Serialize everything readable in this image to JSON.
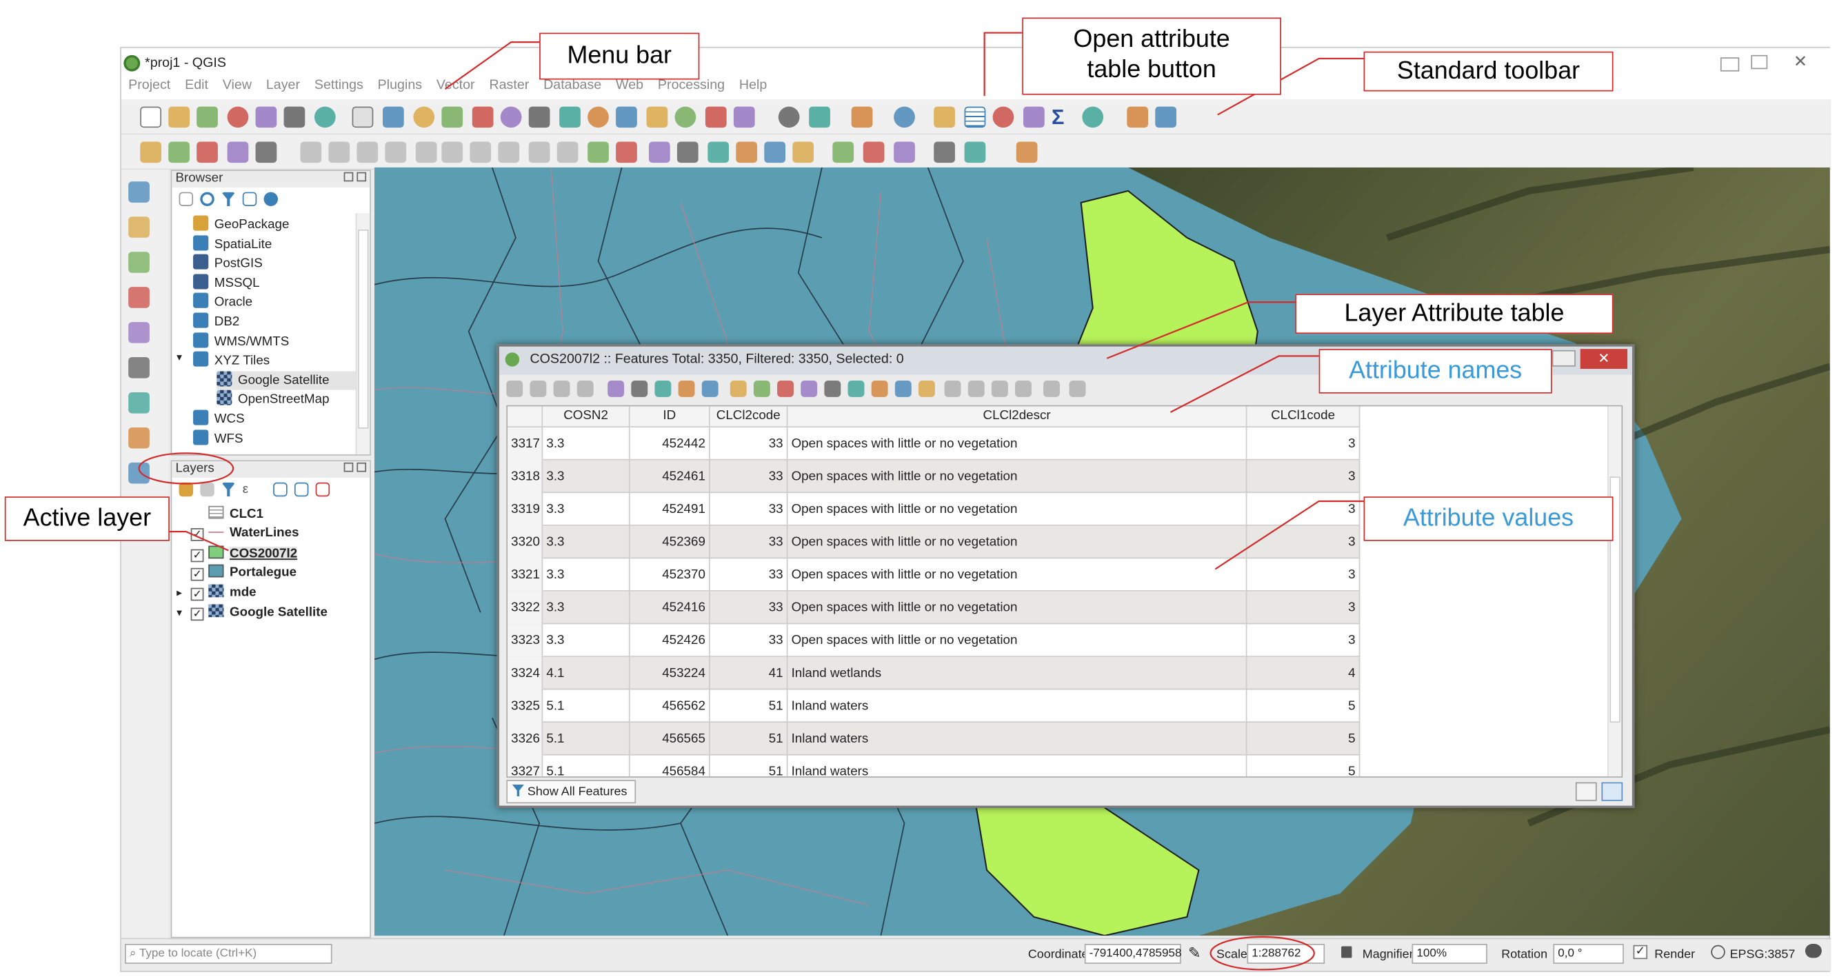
{
  "app": {
    "title": "*proj1 - QGIS"
  },
  "menu": [
    "Project",
    "Edit",
    "View",
    "Layer",
    "Settings",
    "Plugins",
    "Vector",
    "Raster",
    "Database",
    "Web",
    "Processing",
    "Help"
  ],
  "browser": {
    "title": "Browser",
    "items": [
      {
        "label": "GeoPackage",
        "icon": "geopackage-icon"
      },
      {
        "label": "SpatiaLite",
        "icon": "spatialite-icon"
      },
      {
        "label": "PostGIS",
        "icon": "postgis-icon"
      },
      {
        "label": "MSSQL",
        "icon": "mssql-icon"
      },
      {
        "label": "Oracle",
        "icon": "oracle-icon"
      },
      {
        "label": "DB2",
        "icon": "db2-icon"
      },
      {
        "label": "WMS/WMTS",
        "icon": "wms-icon"
      },
      {
        "label": "XYZ Tiles",
        "icon": "xyz-icon"
      },
      {
        "label": "Google Satellite",
        "icon": "tiles-icon"
      },
      {
        "label": "OpenStreetMap",
        "icon": "tiles-icon"
      },
      {
        "label": "WCS",
        "icon": "wcs-icon"
      },
      {
        "label": "WFS",
        "icon": "wfs-icon"
      }
    ]
  },
  "layers": {
    "title": "Layers",
    "items": [
      {
        "label": "CLC1",
        "checked": false,
        "swatch": "table"
      },
      {
        "label": "WaterLines",
        "checked": true,
        "swatch": "line"
      },
      {
        "label": "COS2007l2",
        "checked": true,
        "swatch": "#7fcf7f"
      },
      {
        "label": "Portalegue",
        "checked": true,
        "swatch": "#5b9eb1"
      },
      {
        "label": "mde",
        "checked": true,
        "swatch": "raster"
      },
      {
        "label": "Google Satellite",
        "checked": true,
        "swatch": "raster"
      }
    ]
  },
  "locator": {
    "placeholder": "Type to locate (Ctrl+K)"
  },
  "status": {
    "coordinate_label": "Coordinate",
    "coordinate": "-791400,4785958",
    "scale_label": "Scale",
    "scale": "1:288762",
    "magnifier_label": "Magnifier",
    "magnifier": "100%",
    "rotation_label": "Rotation",
    "rotation": "0,0 °",
    "render_label": "Render",
    "crs": "EPSG:3857"
  },
  "attribute_table": {
    "title": "COS2007l2 :: Features Total: 3350, Filtered: 3350, Selected: 0",
    "columns": [
      "COSN2",
      "ID",
      "CLCl2code",
      "CLCl2descr",
      "CLCl1code"
    ],
    "rows": [
      {
        "n": "3317",
        "cosn2": "3.3",
        "id": "452442",
        "c2": "33",
        "desc": "Open spaces with little or no vegetation",
        "c1": "3"
      },
      {
        "n": "3318",
        "cosn2": "3.3",
        "id": "452461",
        "c2": "33",
        "desc": "Open spaces with little or no vegetation",
        "c1": "3"
      },
      {
        "n": "3319",
        "cosn2": "3.3",
        "id": "452491",
        "c2": "33",
        "desc": "Open spaces with little or no vegetation",
        "c1": "3"
      },
      {
        "n": "3320",
        "cosn2": "3.3",
        "id": "452369",
        "c2": "33",
        "desc": "Open spaces with little or no vegetation",
        "c1": "3"
      },
      {
        "n": "3321",
        "cosn2": "3.3",
        "id": "452370",
        "c2": "33",
        "desc": "Open spaces with little or no vegetation",
        "c1": "3"
      },
      {
        "n": "3322",
        "cosn2": "3.3",
        "id": "452416",
        "c2": "33",
        "desc": "Open spaces with little or no vegetation",
        "c1": "3"
      },
      {
        "n": "3323",
        "cosn2": "3.3",
        "id": "452426",
        "c2": "33",
        "desc": "Open spaces with little or no vegetation",
        "c1": "3"
      },
      {
        "n": "3324",
        "cosn2": "4.1",
        "id": "453224",
        "c2": "41",
        "desc": "Inland wetlands",
        "c1": "4"
      },
      {
        "n": "3325",
        "cosn2": "5.1",
        "id": "456562",
        "c2": "51",
        "desc": "Inland waters",
        "c1": "5"
      },
      {
        "n": "3326",
        "cosn2": "5.1",
        "id": "456565",
        "c2": "51",
        "desc": "Inland waters",
        "c1": "5"
      },
      {
        "n": "3327",
        "cosn2": "5.1",
        "id": "456584",
        "c2": "51",
        "desc": "Inland waters",
        "c1": "5"
      }
    ],
    "filter_button": "Show All Features"
  },
  "callouts": {
    "menu_bar": "Menu bar",
    "open_attr_line1": "Open attribute",
    "open_attr_line2": "table button",
    "standard_toolbar": "Standard toolbar",
    "layer_attr_table": "Layer Attribute table",
    "attr_names": "Attribute names",
    "attr_values": "Attribute values",
    "active_layer": "Active layer"
  },
  "colors": {
    "callout_border": "#d32b2b",
    "callout_blue": "#3a9ad9",
    "water": "#5b9eb1",
    "vegetation": "#b6f35a",
    "boundary": "#c87a8a"
  }
}
